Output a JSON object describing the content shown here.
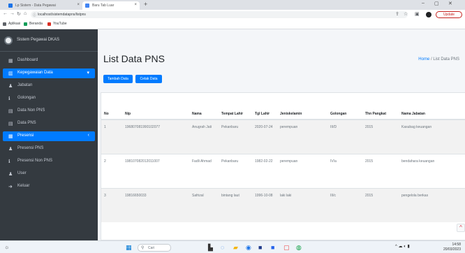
{
  "browser": {
    "tabs": [
      {
        "title": "Lp Sistem - Data Pegawai",
        "color": "#1a73e8"
      },
      {
        "title": "Baru Tab Luar",
        "color": "#4285f4"
      }
    ],
    "new_tab": "+",
    "url": "localhost/sistemdatapns/listpns",
    "update_label": "Update",
    "bookmarks": [
      {
        "label": "Aplikasi",
        "color": "#5f6368"
      },
      {
        "label": "Beranda",
        "color": "#0f9d58"
      },
      {
        "label": "YouTube",
        "color": "#d93025"
      }
    ]
  },
  "sidebar": {
    "brand": "Sistem Pegawai DKAS",
    "items": [
      {
        "label": "Dashboard",
        "icon": "tachometer-icon",
        "glyph": "▦",
        "active": false
      },
      {
        "label": "Kepegawaian Data",
        "icon": "book-icon",
        "glyph": "▥",
        "active": true,
        "chevron": "▾"
      },
      {
        "label": "Jabatan",
        "icon": "user-icon",
        "glyph": "♟",
        "active": false
      },
      {
        "label": "Golongan",
        "icon": "info-icon",
        "glyph": "ℹ",
        "active": false
      },
      {
        "label": "Data Non PNS",
        "icon": "table-icon",
        "glyph": "▤",
        "active": false
      },
      {
        "label": "Data PNS",
        "icon": "table-icon",
        "glyph": "▤",
        "active": false
      },
      {
        "label": "Presensi",
        "icon": "calendar-icon",
        "glyph": "▦",
        "active": true,
        "chevron": "‹"
      },
      {
        "label": "Presensi PNS",
        "icon": "user-icon",
        "glyph": "♟",
        "active": false
      },
      {
        "label": "Presensi Non PNS",
        "icon": "info-icon",
        "glyph": "ℹ",
        "active": false
      },
      {
        "label": "User",
        "icon": "users-icon",
        "glyph": "♟",
        "active": false
      },
      {
        "label": "Keluar",
        "icon": "logout-icon",
        "glyph": "➜",
        "active": false
      }
    ]
  },
  "content": {
    "title": "List Data PNS",
    "breadcrumb": {
      "home": "Home",
      "current": "List Data PNS"
    },
    "buttons": {
      "add": "Tambah Data",
      "print": "Cetak Data"
    },
    "table": {
      "headers": [
        "No",
        "Nip",
        "Nama",
        "Tempat Lahir",
        "Tgl Lahir",
        "Jeniskelamin",
        "Golongan",
        "Thn Pangkat",
        "Nama Jabatan"
      ],
      "rows": [
        [
          "1",
          "196807081990102077",
          "Anugrah Jati",
          "Pekanbaru",
          "2020-07-24",
          "perempuan",
          "III/D",
          "2015",
          "Kasubag keuangan"
        ],
        [
          "2",
          "198107082012011007",
          "Fadli Ahmad",
          "Pekanbaru",
          "1982-02-22",
          "perempuan",
          "IV/a",
          "2015",
          "bendahara keuangan"
        ],
        [
          "3",
          "19816650033",
          "Safrizal",
          "bintang laut",
          "1996-10-08",
          "laki laki",
          "III/c",
          "2015",
          "pengelola berkas"
        ]
      ]
    },
    "scroll_top": "^"
  },
  "taskbar": {
    "search_placeholder": "Cari",
    "tray": "^ ☁ ◐ ▮",
    "time": "14:58",
    "date": "20/03/2023"
  }
}
